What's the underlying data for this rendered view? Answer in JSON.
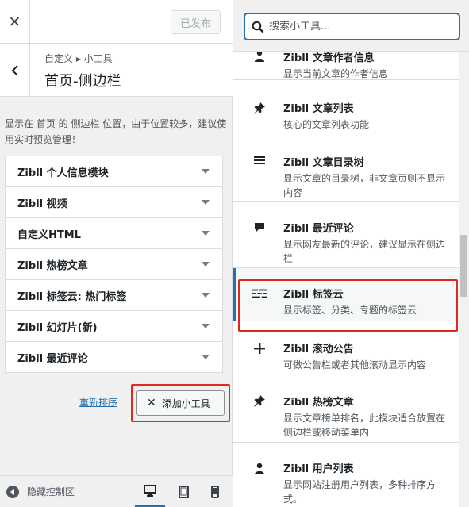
{
  "topbar": {
    "close_icon": "close-icon",
    "publish_label": "已发布"
  },
  "section": {
    "breadcrumb": "自定义 ▸ 小工具",
    "title": "首页-侧边栏",
    "back_icon": "chevron-left-icon"
  },
  "description": "显示在 首页 的 侧边栏 位置，由于位置较多，建议使用实时预览管理！",
  "widgets": [
    {
      "label": "Zibll 个人信息模块"
    },
    {
      "label": "Zibll 视频"
    },
    {
      "label": "自定义HTML"
    },
    {
      "label": "Zibll 热榜文章"
    },
    {
      "label": "Zibll 标签云: 热门标签"
    },
    {
      "label": "Zibll 幻灯片(新)"
    },
    {
      "label": "Zibll 最近评论"
    }
  ],
  "actions": {
    "reorder_label": "重新排序",
    "add_widget_label": "添加小工具",
    "add_widget_icon": "x-icon"
  },
  "footer": {
    "hide_controls_label": "隐藏控制区",
    "devices": [
      "desktop-icon",
      "tablet-icon",
      "mobile-icon"
    ]
  },
  "search": {
    "placeholder": "搜索小工具...",
    "value": ""
  },
  "available_widgets": [
    {
      "icon": "person-icon",
      "name": "Zibll 文章作者信息",
      "desc": "显示当前文章的作者信息"
    },
    {
      "icon": "pin-icon",
      "name": "Zibll 文章列表",
      "desc": "核心的文章列表功能"
    },
    {
      "icon": "menu-icon",
      "name": "Zibll 文章目录树",
      "desc": "显示文章的目录树，非文章页则不显示内容"
    },
    {
      "icon": "comment-icon",
      "name": "Zibll 最近评论",
      "desc": "显示网友最新的评论，建议显示在侧边栏"
    },
    {
      "icon": "tag-cloud-icon",
      "name": "Zibll 标签云",
      "desc": "显示标签、分类、专题的标签云"
    },
    {
      "icon": "plus-icon",
      "name": "Zibll 滚动公告",
      "desc": "可做公告栏或者其他滚动显示内容"
    },
    {
      "icon": "pin-icon",
      "name": "Zibll 热榜文章",
      "desc": "显示文章榜单排名，此模块适合放置在侧边栏或移动菜单内"
    },
    {
      "icon": "person-icon",
      "name": "Zibll 用户列表",
      "desc": "显示网站注册用户列表，多种排序方式。"
    }
  ],
  "colors": {
    "accent": "#2271b1",
    "highlight": "#e0281f",
    "text": "#1d2327",
    "muted": "#50575e"
  }
}
